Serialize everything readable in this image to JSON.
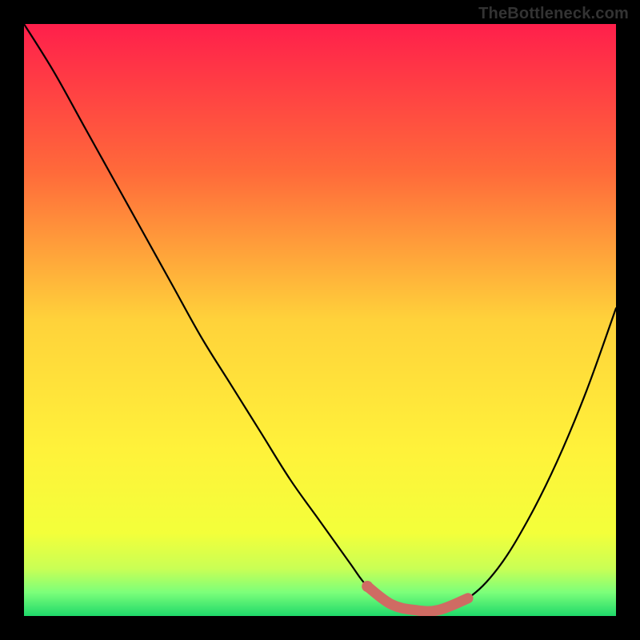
{
  "watermark": "TheBottleneck.com",
  "chart_data": {
    "type": "line",
    "title": "",
    "xlabel": "",
    "ylabel": "",
    "xlim": [
      0,
      100
    ],
    "ylim": [
      0,
      100
    ],
    "series": [
      {
        "name": "curve",
        "x": [
          0,
          5,
          10,
          15,
          20,
          25,
          30,
          35,
          40,
          45,
          50,
          55,
          58,
          62,
          66,
          70,
          75,
          80,
          85,
          90,
          95,
          100
        ],
        "y": [
          100,
          92,
          83,
          74,
          65,
          56,
          47,
          39,
          31,
          23,
          16,
          9,
          5,
          2,
          1,
          1,
          3,
          8,
          16,
          26,
          38,
          52
        ]
      }
    ],
    "highlight_band": {
      "x_start": 58,
      "x_end": 75,
      "color": "#cf6b63"
    },
    "background_gradient": {
      "stops": [
        {
          "offset": 0.0,
          "color": "#ff1f4b"
        },
        {
          "offset": 0.25,
          "color": "#ff6a3a"
        },
        {
          "offset": 0.5,
          "color": "#ffd23a"
        },
        {
          "offset": 0.72,
          "color": "#fff23a"
        },
        {
          "offset": 0.86,
          "color": "#f3ff3a"
        },
        {
          "offset": 0.92,
          "color": "#c9ff55"
        },
        {
          "offset": 0.96,
          "color": "#7cff7a"
        },
        {
          "offset": 1.0,
          "color": "#1fd96a"
        }
      ]
    }
  }
}
